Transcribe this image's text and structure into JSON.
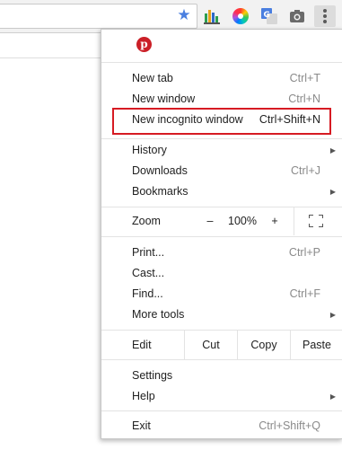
{
  "toolbar": {
    "icons": [
      "star-icon",
      "bar-chart-extension-icon",
      "color-wheel-extension-icon",
      "translate-extension-icon",
      "camera-extension-icon",
      "more-vert-icon"
    ],
    "star_color": "#4a7fe0"
  },
  "menu": {
    "extension_icons": [
      "pinterest-icon"
    ],
    "pinterest_glyph": "p",
    "items_group1": [
      {
        "label": "New tab",
        "shortcut": "Ctrl+T"
      },
      {
        "label": "New window",
        "shortcut": "Ctrl+N"
      },
      {
        "label": "New incognito window",
        "shortcut": "Ctrl+Shift+N"
      }
    ],
    "items_group2": [
      {
        "label": "History",
        "submenu": true
      },
      {
        "label": "Downloads",
        "shortcut": "Ctrl+J"
      },
      {
        "label": "Bookmarks",
        "submenu": true
      }
    ],
    "zoom": {
      "label": "Zoom",
      "minus": "–",
      "value": "100%",
      "plus": "+"
    },
    "items_group3": [
      {
        "label": "Print...",
        "shortcut": "Ctrl+P"
      },
      {
        "label": "Cast..."
      },
      {
        "label": "Find...",
        "shortcut": "Ctrl+F"
      },
      {
        "label": "More tools",
        "submenu": true
      }
    ],
    "edit": {
      "label": "Edit",
      "cut": "Cut",
      "copy": "Copy",
      "paste": "Paste"
    },
    "items_group4": [
      {
        "label": "Settings"
      },
      {
        "label": "Help",
        "submenu": true
      }
    ],
    "exit": {
      "label": "Exit",
      "shortcut": "Ctrl+Shift+Q"
    },
    "highlight_color": "#d61b23",
    "arrow_glyph": "▶"
  }
}
